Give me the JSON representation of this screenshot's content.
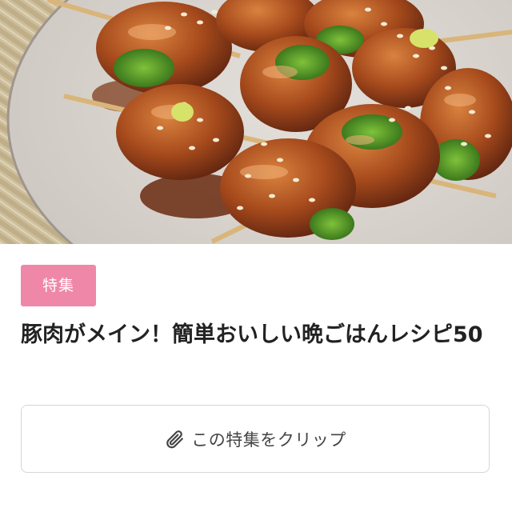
{
  "hero": {
    "image_alt": "skewered pork rolls with green onions in glaze"
  },
  "badge": {
    "label": "特集",
    "color": "#ef88a8"
  },
  "title": {
    "text": "豚肉がメイン！簡単おいしい晩ごはんレシピ50"
  },
  "clip_button": {
    "label": "この特集をクリップ",
    "icon": "paperclip-icon"
  }
}
